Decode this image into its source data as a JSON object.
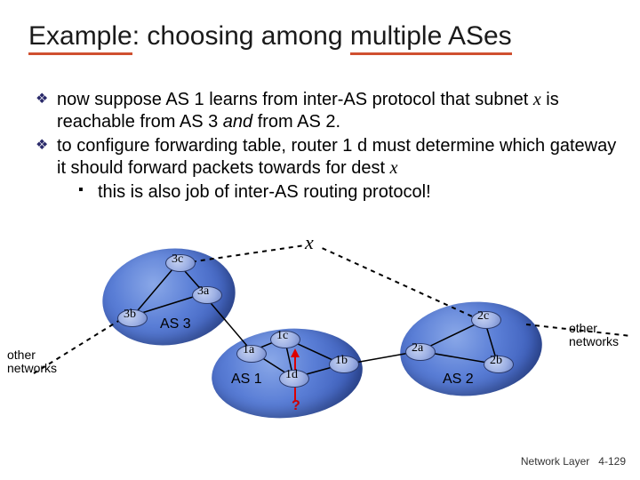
{
  "title_a": "Example",
  "title_b": ": choosing among ",
  "title_c": "multiple ",
  "title_d": "ASes",
  "bullet1_a": "now suppose AS 1 learns from inter-AS protocol that subnet ",
  "bullet1_x": "x",
  "bullet1_b": " is reachable from AS 3 ",
  "bullet1_and": "and",
  "bullet1_c": " from AS 2.",
  "bullet2_a": "to configure forwarding table, router 1 d must determine which gateway it should forward packets towards for dest ",
  "bullet2_x": "x",
  "sub1": "this is also  job of inter-AS routing protocol!",
  "x_label": "x",
  "r": {
    "3c": "3c",
    "3a": "3a",
    "3b": "3b",
    "1a": "1a",
    "1c": "1c",
    "1d": "1d",
    "1b": "1b",
    "2a": "2a",
    "2b": "2b",
    "2c": "2c"
  },
  "as1": "AS 1",
  "as2": "AS 2",
  "as3": "AS 3",
  "other": "other\nnetworks",
  "qmark": "?",
  "foot_a": "Network Layer",
  "foot_b": "4-129"
}
